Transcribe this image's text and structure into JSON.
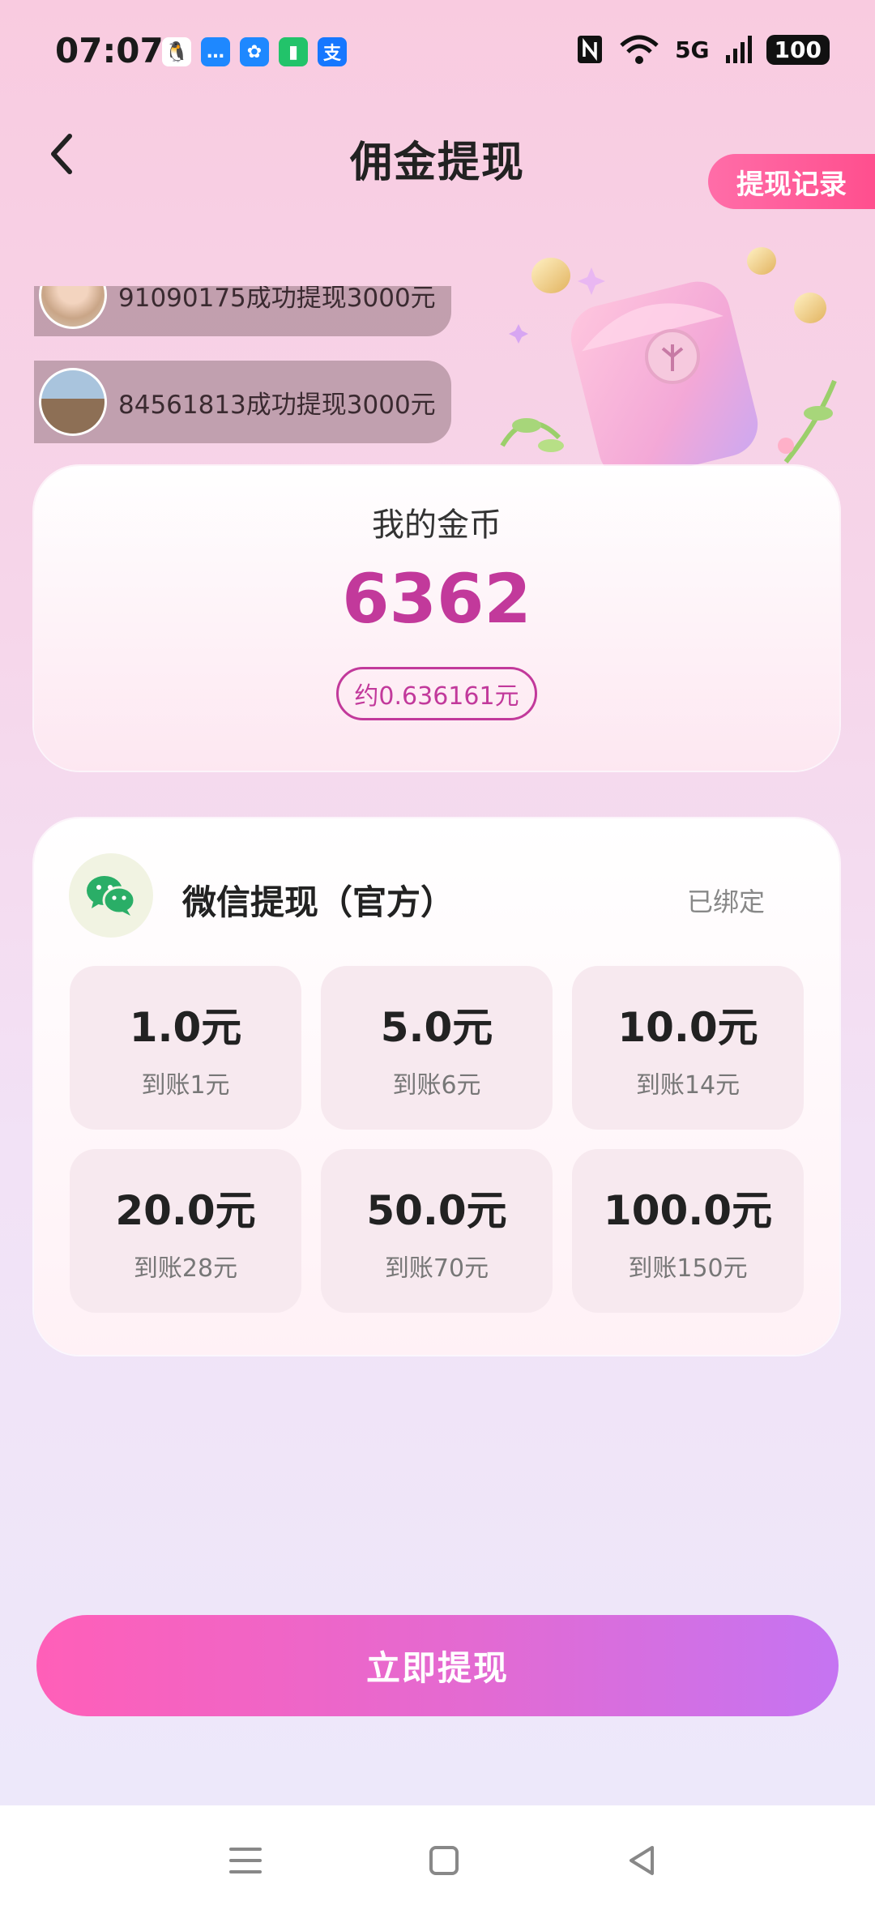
{
  "status_bar": {
    "time": "07:07",
    "network": "5G",
    "battery": "100",
    "notification_icons": [
      "qq-icon",
      "message-icon",
      "pinwheel-icon",
      "battery-saver-icon",
      "alipay-icon"
    ],
    "notification_glyphs": [
      "🐧",
      "…",
      "✿",
      "▮",
      "支"
    ],
    "notification_colors": [
      "#ffffff",
      "#1e88ff",
      "#1e88ff",
      "#22c36a",
      "#1677ff"
    ]
  },
  "header": {
    "title": "佣金提现",
    "records_button": "提现记录"
  },
  "ticker": {
    "items": [
      "91090175成功提现3000元",
      "84561813成功提现3000元"
    ]
  },
  "coins": {
    "label": "我的金币",
    "value": "6362",
    "approx": "约0.636161元"
  },
  "withdraw": {
    "method": "微信提现（官方）",
    "status": "已绑定",
    "options": [
      {
        "amount": "1.0元",
        "arrival": "到账1元"
      },
      {
        "amount": "5.0元",
        "arrival": "到账6元"
      },
      {
        "amount": "10.0元",
        "arrival": "到账14元"
      },
      {
        "amount": "20.0元",
        "arrival": "到账28元"
      },
      {
        "amount": "50.0元",
        "arrival": "到账70元"
      },
      {
        "amount": "100.0元",
        "arrival": "到账150元"
      }
    ]
  },
  "submit_button": "立即提现",
  "colors": {
    "accent": "#c2399b",
    "records_button": "#ff4f8e",
    "wechat_green": "#2aae67"
  }
}
